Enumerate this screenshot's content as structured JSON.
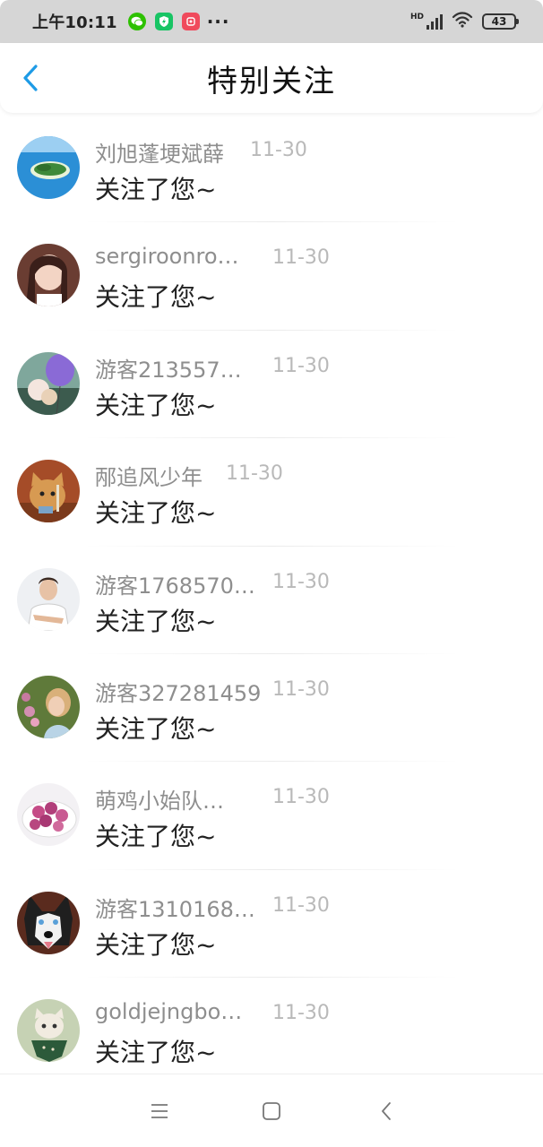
{
  "status_bar": {
    "time": "上午10:11",
    "more": "···",
    "hd": "HD",
    "battery": "43",
    "icons": [
      "wechat-icon",
      "shield-icon",
      "app-icon",
      "signal-icon",
      "wifi-icon",
      "battery-icon"
    ]
  },
  "header": {
    "title": "特别关注",
    "back_icon": "chevron-left-icon",
    "accent": "#1e9be6"
  },
  "items": [
    {
      "name": "刘旭蓬埂斌薛",
      "date": "11-30",
      "message": "关注了您~",
      "avatar": "island-photo"
    },
    {
      "name": "sergiroonro…",
      "date": "11-30",
      "message": "关注了您~",
      "avatar": "girl-photo"
    },
    {
      "name": "游客213557…",
      "date": "11-30",
      "message": "关注了您~",
      "avatar": "balloon-photo"
    },
    {
      "name": "邴追风少年",
      "date": "11-30",
      "message": "关注了您~",
      "avatar": "cat-photo"
    },
    {
      "name": "游客1768570…",
      "date": "11-30",
      "message": "关注了您~",
      "avatar": "man-photo"
    },
    {
      "name": "游客327281459",
      "date": "11-30",
      "message": "关注了您~",
      "avatar": "woman-flowers-photo"
    },
    {
      "name": "萌鸡小始队…",
      "date": "11-30",
      "message": "关注了您~",
      "avatar": "fruit-bowl-photo"
    },
    {
      "name": "游客1310168…",
      "date": "11-30",
      "message": "关注了您~",
      "avatar": "husky-photo"
    },
    {
      "name": "goldjejngbo…",
      "date": "11-30",
      "message": "关注了您~",
      "avatar": "cat-scarf-photo"
    }
  ],
  "navbar": {
    "icons": [
      "menu-icon",
      "home-square-icon",
      "back-triangle-icon"
    ]
  }
}
